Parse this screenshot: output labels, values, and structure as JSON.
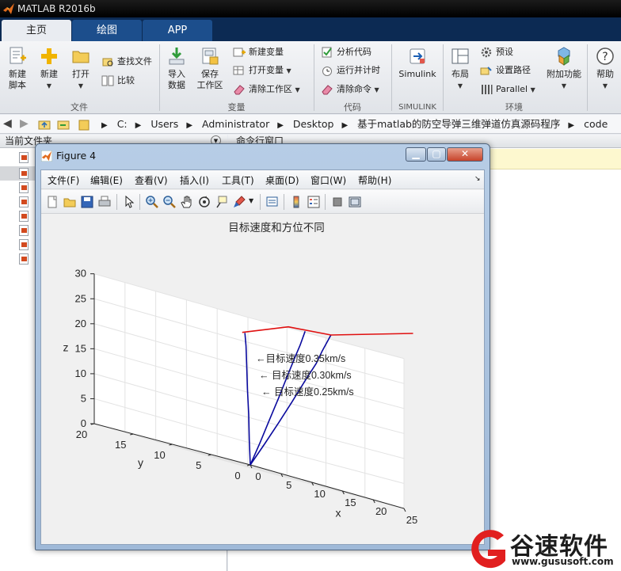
{
  "app": {
    "title": "MATLAB R2016b",
    "tabs": [
      {
        "label": "主页",
        "active": true
      },
      {
        "label": "绘图",
        "active": false
      },
      {
        "label": "APP",
        "active": false
      }
    ]
  },
  "ribbon": {
    "file": {
      "group_label": "文件",
      "new_script": "新建\n脚本",
      "new": "新建",
      "open": "打开",
      "find_files": "查找文件",
      "compare": "比较"
    },
    "variable": {
      "group_label": "变量",
      "import": "导入\n数据",
      "save_ws": "保存\n工作区",
      "new_var": "新建变量",
      "open_var": "打开变量",
      "clear_ws": "清除工作区"
    },
    "code": {
      "group_label": "代码",
      "analyze": "分析代码",
      "run_time": "运行并计时",
      "clear_cmd": "清除命令"
    },
    "simulink": {
      "group_label": "SIMULINK",
      "label": "Simulink"
    },
    "env": {
      "group_label": "环境",
      "layout": "布局",
      "prefs": "预设",
      "set_path": "设置路径",
      "parallel": "Parallel",
      "addons": "附加功能"
    },
    "resources": {
      "help": "帮助"
    }
  },
  "address": {
    "path": [
      "C:",
      "Users",
      "Administrator",
      "Desktop",
      "基于matlab的防空导弹三维弹道仿真源码程序",
      "code"
    ]
  },
  "panels": {
    "current_folder": "当前文件夹",
    "command_window": "命令行窗口"
  },
  "figure": {
    "title": "Figure 4",
    "menus": [
      "文件(F)",
      "编辑(E)",
      "查看(V)",
      "插入(I)",
      "工具(T)",
      "桌面(D)",
      "窗口(W)",
      "帮助(H)"
    ]
  },
  "chart_data": {
    "type": "line",
    "title": "目标速度和方位不同",
    "xlabel": "x",
    "ylabel": "y",
    "zlabel": "z",
    "xlim": [
      0,
      25
    ],
    "ylim": [
      0,
      20
    ],
    "zlim": [
      0,
      30
    ],
    "xticks": [
      0,
      5,
      10,
      15,
      20,
      25
    ],
    "yticks": [
      0,
      5,
      10,
      15,
      20
    ],
    "zticks": [
      0,
      5,
      10,
      15,
      20,
      25,
      30
    ],
    "grid": true,
    "annotations": [
      "←目标速度0.35km/s",
      "← 目标速度0.30km/s",
      "← 目标速度0.25km/s"
    ],
    "series": [
      {
        "color": "#0a0a9e",
        "points": [
          [
            0,
            0,
            0
          ],
          [
            1.7,
            -0.5,
            5
          ],
          [
            3.4,
            -0.95,
            10
          ],
          [
            5.1,
            -1.35,
            15
          ],
          [
            6.8,
            -1.7,
            20
          ],
          [
            8.2,
            -2.0,
            24
          ],
          [
            9.0,
            -2.1,
            26.7
          ],
          [
            10.2,
            -2.3,
            30.5
          ]
        ]
      },
      {
        "color": "#0a0a9e",
        "points": [
          [
            0,
            0,
            0
          ],
          [
            1.2,
            -0.3,
            5
          ],
          [
            2.4,
            -0.55,
            10
          ],
          [
            3.6,
            -0.8,
            15
          ],
          [
            4.8,
            -1.0,
            20
          ],
          [
            5.8,
            -1.15,
            24
          ],
          [
            6.5,
            -1.25,
            26.7
          ],
          [
            7.2,
            -1.35,
            29.8
          ]
        ]
      },
      {
        "color": "#0a0a9e",
        "points": [
          [
            0,
            0,
            0
          ],
          [
            0.6,
            0.6,
            5
          ],
          [
            1.2,
            1.15,
            10
          ],
          [
            1.7,
            1.7,
            15
          ],
          [
            2.2,
            2.2,
            20
          ],
          [
            2.6,
            2.6,
            23.6
          ],
          [
            2.8,
            2.9,
            26.2
          ]
        ]
      },
      {
        "color": "#e01010",
        "points": [
          [
            4.4,
            4.5,
            26.2
          ],
          [
            7.2,
            0.8,
            29.8
          ],
          [
            10.2,
            -2.3,
            30.5
          ],
          [
            16.2,
            -8.1,
            35.3
          ]
        ]
      }
    ]
  },
  "watermark": {
    "text": "谷速软件",
    "url": "www.gususoft.com"
  }
}
